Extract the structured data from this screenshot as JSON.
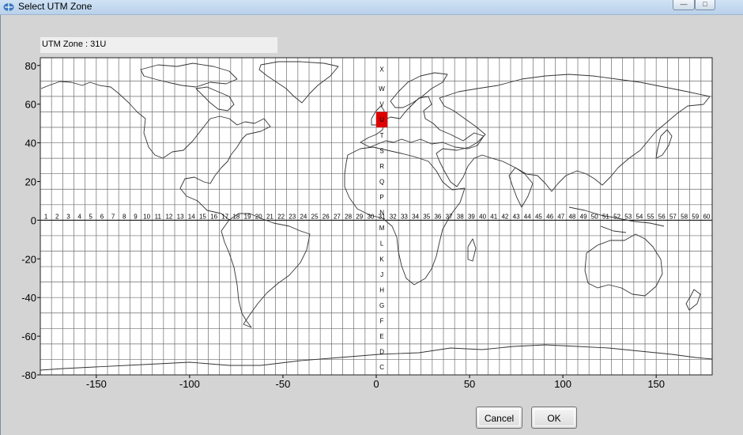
{
  "window": {
    "title": "Select UTM Zone",
    "icon": "globe-icon"
  },
  "zone_label": "UTM Zone : 31U",
  "selection": {
    "zone": 31,
    "band": "U",
    "highlight_color": "#e00000"
  },
  "map": {
    "lon_range": [
      -180,
      180
    ],
    "lat_range": [
      -80,
      84
    ],
    "x_ticks": [
      -150,
      -100,
      -50,
      0,
      50,
      100,
      150
    ],
    "y_ticks": [
      80,
      60,
      40,
      20,
      0,
      -20,
      -40,
      -60,
      -80
    ],
    "bands": [
      "C",
      "D",
      "E",
      "F",
      "G",
      "H",
      "J",
      "K",
      "L",
      "M",
      "N",
      "P",
      "Q",
      "R",
      "S",
      "T",
      "U",
      "V",
      "W",
      "X"
    ],
    "zones_count": 60,
    "grid_color": "#6e6e6e",
    "coast_color": "#333333"
  },
  "buttons": {
    "cancel": "Cancel",
    "ok": "OK"
  }
}
